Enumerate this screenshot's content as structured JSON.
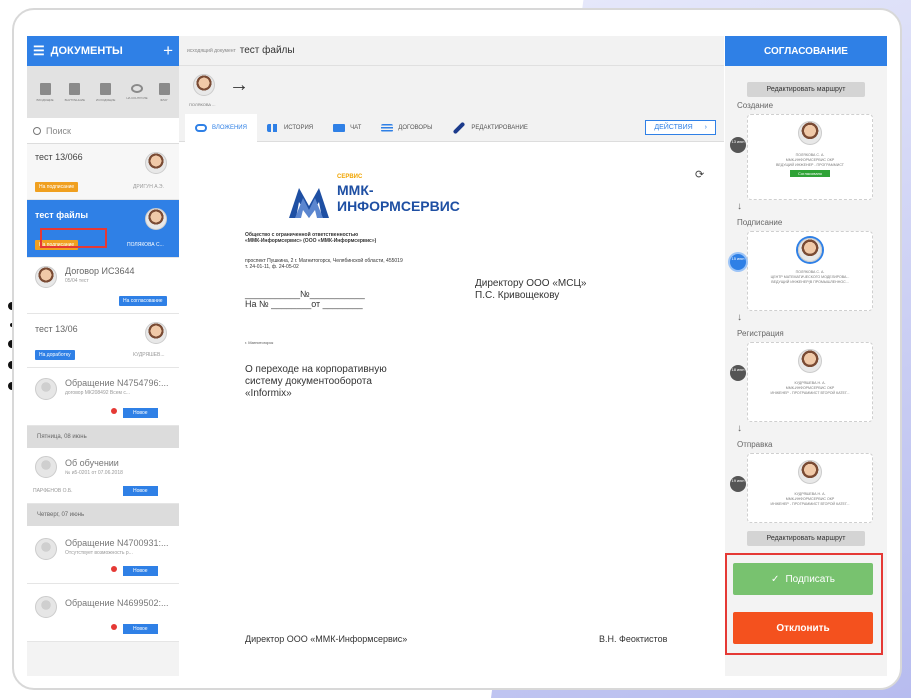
{
  "sidebar": {
    "title": "ДОКУМЕНТЫ",
    "add_icon": "plus",
    "toolbar_icons": [
      {
        "icon": "archive-icon",
        "label": "ВХОДЯЩИЕ"
      },
      {
        "icon": "download-icon",
        "label": "ВНУТРЕННИЕ"
      },
      {
        "icon": "upload-icon",
        "label": "ИСХОДЯЩИЕ"
      },
      {
        "icon": "eye-icon",
        "label": "НА КОНТРОЛЕ"
      },
      {
        "icon": "flag-icon",
        "label": "ФЛАГ"
      }
    ],
    "search_placeholder": "Поиск",
    "items": [
      {
        "title": "тест 13/066",
        "badge": "На подписание",
        "person": "ДРИГУН А.Э."
      },
      {
        "title": "тест файлы",
        "badge": "На подписание",
        "person": "ПОЛЯКОВА С..."
      },
      {
        "title": "Договор ИС3644",
        "sub": "05/04 тест",
        "badge": "На согласование"
      },
      {
        "title": "тест 13/06",
        "badge": "На доработку",
        "person": "КУДРЯШЕВ..."
      },
      {
        "title": "Обращение N4754796:...",
        "sub": "договор МК208492  Всем с...",
        "badge": "Новое"
      }
    ],
    "date_sep_1": "Пятница, 08 июнь",
    "items_2": [
      {
        "title": "Об обучении",
        "sub": "№ и5-0201 от 07.06.2018",
        "person": "ПАРФЕНОВ О.Б.",
        "badge": "Новое"
      }
    ],
    "date_sep_2": "Четверг, 07 июнь",
    "items_3": [
      {
        "title": "Обращение N4700931:...",
        "sub": "Отсутствует возможность р...",
        "badge": "Новое"
      },
      {
        "title": "Обращение N4699502:...",
        "badge": "Новое"
      }
    ]
  },
  "main": {
    "doc_type": "исходящий документ",
    "doc_title": "тест файлы",
    "route_person": "ПОЛЯКОВА ...",
    "tabs": [
      "ВЛОЖЕНИЯ",
      "ИСТОРИЯ",
      "ЧАТ",
      "ДОГОВОРЫ",
      "РЕДАКТИРОВАНИЕ"
    ],
    "actions": "ДЕЙСТВИЯ",
    "document": {
      "logo_service": "СЕРВИС",
      "logo_name": "ММК-ИНФОРМСЕРВИС",
      "org_line1": "Общество с ограниченной ответственностью",
      "org_line2": "«ММК-Информсервис» (ООО «ММК-Информсервис»)",
      "addr_line1": "проспект Пушкина, 2 г. Магнитогорск, Челябинской области, 455019",
      "addr_line2": "т. 24-01-11, ф. 24-05-02",
      "num_line1": "___________№___________",
      "num_line2": "На №  ________от ________",
      "city": "г. Магнитогорск",
      "recipient_line1": "Директору ООО «МСЦ»",
      "recipient_line2": "П.С. Кривощекову",
      "subject_line1": "О переходе на корпоративную",
      "subject_line2": "систему документооборота",
      "subject_line3": "«Informix»",
      "signer_title": "Директор ООО «ММК-Информсервис»",
      "signer_name": "В.Н. Феоктистов"
    }
  },
  "approval": {
    "title": "СОГЛАСОВАНИЕ",
    "edit_route": "Редактировать маршрут",
    "stages": [
      {
        "label": "Создание",
        "date": "13 июн",
        "name": "ПОЛЯКОВА С. А.",
        "org": "ММК-ИНФОРМСЕРВИС ОКР",
        "role": "ВЕДУЩИЙ ИНЖЕНЕР - ПРОГРАММИСТ",
        "status": "Согласовано"
      },
      {
        "label": "Подписание",
        "date": "15 июн",
        "name": "ПОЛЯКОВА С. А.",
        "org": "ЦЕНТР МАТЕМАТИЧЕСКОГО МОДЕЛИРОВА...",
        "role": "ВЕДУЩИЙ ИНЖЕНЕР(В ПРОМЫШЛЕННОС..."
      },
      {
        "label": "Регистрация",
        "date": "18 июн",
        "name": "КУДРЯШЕВА Н. А.",
        "org": "ММК-ИНФОРМСЕРВИС ОКР",
        "role": "ИНЖЕНЕР - ПРОГРАММИСТ ВТОРОЙ КАТЕГ..."
      },
      {
        "label": "Отправка",
        "date": "19 июн",
        "name": "КУДРЯШЕВА Н. А.",
        "org": "ММК-ИНФОРМСЕРВИС ОКР",
        "role": "ИНЖЕНЕР - ПРОГРАММИСТ ВТОРОЙ КАТЕГ..."
      }
    ],
    "sign": "Подписать",
    "reject": "Отклонить"
  },
  "colors": {
    "primary": "#2f80e6",
    "sign": "#78c26f",
    "reject": "#f4511e",
    "highlight": "#e53935"
  }
}
